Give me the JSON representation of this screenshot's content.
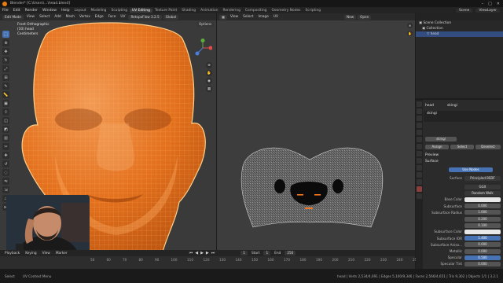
{
  "titlebar": {
    "title": "Blender* [C:\\Users\\...\\head.blend]",
    "minimize": "–",
    "maximize": "□",
    "close": "✕"
  },
  "menubar": {
    "menus": [
      "File",
      "Edit",
      "Render",
      "Window",
      "Help"
    ],
    "workspaces": [
      "Layout",
      "Modeling",
      "Sculpting",
      "UV Editing",
      "Texture Paint",
      "Shading",
      "Animation",
      "Rendering",
      "Compositing",
      "Geometry Nodes",
      "Scripting"
    ],
    "active_workspace": "UV Editing",
    "scene": "Scene",
    "view_layer": "ViewLayer"
  },
  "viewport3d": {
    "mode": "Edit Mode",
    "menus": [
      "View",
      "Select",
      "Add",
      "Mesh",
      "Vertex",
      "Edge",
      "Face",
      "UV"
    ],
    "addon": "RetopoFlow 3.2.5",
    "transform": "Global",
    "options": "Options",
    "info_lines": [
      "Front Orthographic",
      "(10) head",
      "Centimeters"
    ]
  },
  "tools": [
    "select-icon",
    "cursor-icon",
    "move-icon",
    "rotate-icon",
    "scale-icon",
    "transform-icon",
    "annotate-icon",
    "measure-icon",
    "add-cube-icon",
    "extrude-icon",
    "inset-icon",
    "bevel-icon",
    "loopcut-icon",
    "knife-icon",
    "polybuild-icon",
    "spin-icon",
    "smooth-icon",
    "edge-slide-icon",
    "shrink-icon",
    "shear-icon",
    "rip-icon"
  ],
  "uv_editor": {
    "menus": [
      "View",
      "Select",
      "Image",
      "UV"
    ],
    "image_field": "New",
    "open_button": "Open"
  },
  "timeline": {
    "menus": [
      "Playback",
      "Keying",
      "View",
      "Marker"
    ],
    "current_frame": "1",
    "start_label": "Start",
    "start": "1",
    "end_label": "End",
    "end": "250",
    "ticks": [
      "50",
      "60",
      "70",
      "80",
      "90",
      "100",
      "110",
      "120",
      "130",
      "140",
      "150",
      "160",
      "170",
      "180",
      "190",
      "200",
      "210",
      "220",
      "230",
      "240",
      "250"
    ]
  },
  "statusbar": {
    "left": "Select",
    "middle": "UV Context Menu",
    "right": "head | Verts 2,534/4,691 | Edges 5,100/9,346 | Faces 2,566/4,651 | Tris 9,302 | Objects 1/1 | 3.2.1"
  },
  "outliner": {
    "rows": [
      "Scene Collection",
      "Collection",
      "head"
    ]
  },
  "properties": {
    "breadcrumb": [
      "head",
      "skingi"
    ],
    "material_slot": "skingi",
    "material_name": "skingi",
    "buttons": [
      "Assign",
      "Select",
      "Deselect"
    ],
    "sections": [
      "Preview",
      "Surface"
    ],
    "use_nodes": "Use Nodes",
    "surface_label": "Surface",
    "surface_value": "Principled BSDF",
    "rows": [
      {
        "label": "",
        "value": "GGX"
      },
      {
        "label": "",
        "value": "Random Walk"
      },
      {
        "label": "Base Color",
        "value": ""
      },
      {
        "label": "Subsurface",
        "value": "0.000"
      },
      {
        "label": "Subsurface Radius",
        "value": "1.000"
      },
      {
        "label": "",
        "value": "0.200"
      },
      {
        "label": "",
        "value": "0.100"
      },
      {
        "label": "Subsurface Color",
        "value": ""
      },
      {
        "label": "Subsurface IOR",
        "value": "1.400"
      },
      {
        "label": "Subsurface Aniso...",
        "value": "0.000"
      },
      {
        "label": "Metallic",
        "value": "0.000"
      },
      {
        "label": "Specular",
        "value": "0.500"
      },
      {
        "label": "Specular Tint",
        "value": "0.000"
      }
    ]
  },
  "colors": {
    "mesh_orange": "#e8711c",
    "wire_yellow": "#ffb347",
    "accent_blue": "#4772b3",
    "uv_mesh": "#d8d8d8"
  }
}
